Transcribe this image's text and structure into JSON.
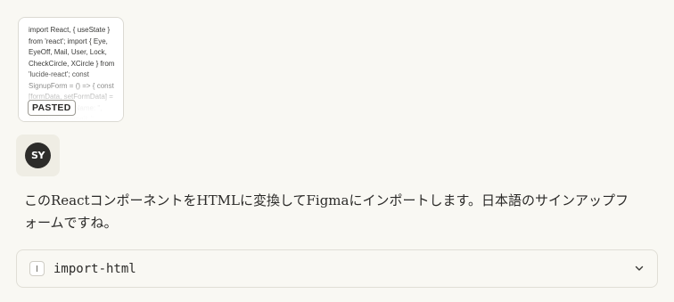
{
  "attachment": {
    "preview_text": "import React, { useState } from 'react'; import { Eye, EyeOff, Mail, User, Lock, CheckCircle, XCircle } from 'lucide-react'; const SignupForm = () => { const [formData, setFormData] = useState({ lastName: '', firstName: '', email: '',",
    "badge": "PASTED"
  },
  "user": {
    "avatar_initials": "SY"
  },
  "message": {
    "text": "このReactコンポーネントをHTMLに変換してFigmaにインポートします。日本語のサインアップフォームですね。"
  },
  "tool_call": {
    "label": "import-html",
    "icon": "terminal-icon",
    "chevron": "chevron-down-icon"
  },
  "colors": {
    "background": "#f9f8f3",
    "avatar_bg": "#2d2c2a",
    "text": "#2b2a28",
    "border": "#e0ded6"
  }
}
